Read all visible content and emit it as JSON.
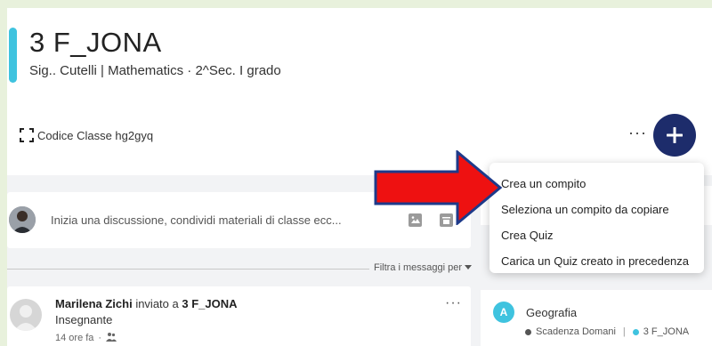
{
  "header": {
    "class_name": "3 F_JONA",
    "subtitle": "Sig.. Cutelli | Mathematics  · 2^Sec. I grado",
    "class_code": "Codice Classe hg2gyq",
    "more_label": "···",
    "add_label": "+"
  },
  "feed": {
    "post_prompt": "Inizia una discussione, condividi materiali di classe ecc...",
    "filter_label": "Filtra i messaggi per",
    "messages": [
      {
        "author": "Marilena Zichi",
        "action": " inviato a ",
        "target": "3 F_JONA",
        "role": "Insegnante",
        "time": "14 ore fa",
        "more": "···"
      }
    ]
  },
  "menu": {
    "items": [
      "Crea un compito",
      "Seleziona un compito da copiare",
      "Crea Quiz",
      "Carica un Quiz creato in precedenza"
    ]
  },
  "upcoming": {
    "subject": "Geografia",
    "deadline": "Scadenza Domani",
    "class_name": "3 F_JONA",
    "icon_letter": "A"
  },
  "colors": {
    "accent": "#3fc3df",
    "fab": "#1d2c6b",
    "arrow": "#ee1111",
    "arrow_border": "#1e3a8a"
  }
}
